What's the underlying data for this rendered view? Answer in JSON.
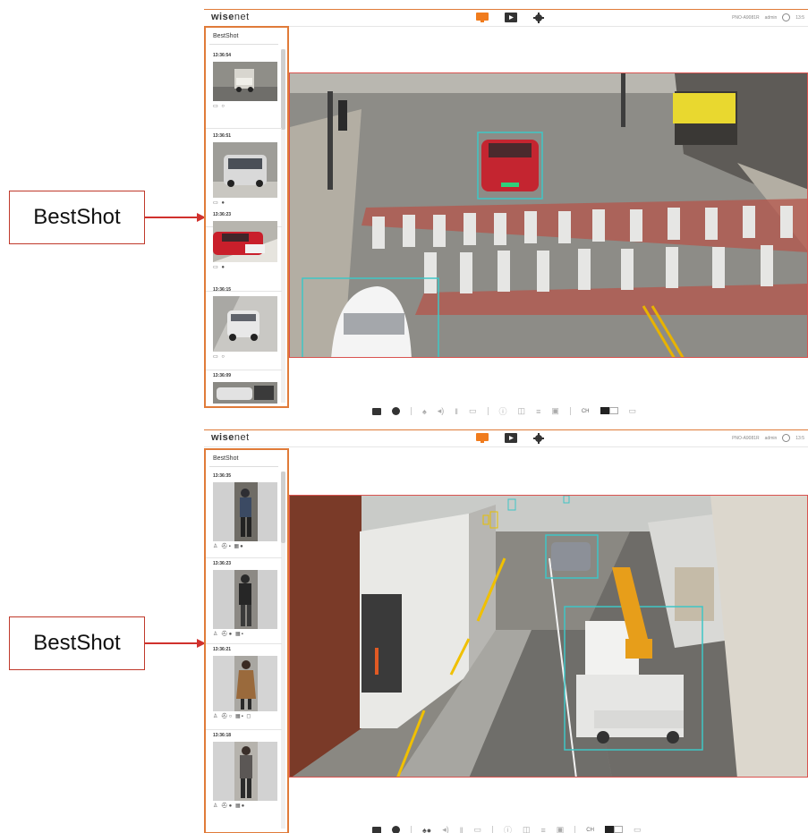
{
  "callouts": [
    {
      "label": "BestShot"
    },
    {
      "label": "BestShot"
    }
  ],
  "screens": [
    {
      "logo_bold": "wise",
      "logo_rest": "net",
      "top_right": "PNO-A9081R",
      "user": "admin",
      "time": "13:5",
      "panel_title": "BestShot",
      "entries": [
        {
          "time": "13:36:54",
          "icons": "▭ ○"
        },
        {
          "time": "13:36:51",
          "icons": "▭ ●"
        },
        {
          "time": "13:36:23",
          "icons": "▭ ●"
        },
        {
          "time": "13:36:15",
          "icons": "▭ ○"
        },
        {
          "time": "13:36:09",
          "icons": ""
        }
      ],
      "ch_label": "CH"
    },
    {
      "logo_bold": "wise",
      "logo_rest": "net",
      "top_right": "PNO-A9081R",
      "user": "admin",
      "time": "13:5",
      "panel_title": "BestShot",
      "entries": [
        {
          "time": "13:36:35",
          "icons": "♙ ⛑▪ ▦●"
        },
        {
          "time": "13:36:23",
          "icons": "♙ ⛑● ▦▪"
        },
        {
          "time": "13:36:21",
          "icons": "♙ ⛑○ ▦▪ ◻"
        },
        {
          "time": "13:36:18",
          "icons": "♙ ⛑● ▦●"
        }
      ],
      "ch_label": "CH"
    }
  ],
  "colors": {
    "accent": "#e07b39",
    "brand_orange": "#f07c1e",
    "alert_red": "#d9534f",
    "detection": "#3ec6c6"
  },
  "icons": [
    "monitor-icon",
    "playback-icon",
    "gear-icon",
    "clock-icon",
    "camera-icon",
    "record-icon",
    "alarm-icon",
    "audio-icon",
    "mic-icon",
    "region-icon",
    "info-icon",
    "rotate-icon",
    "text-icon",
    "overlay-icon",
    "channel-icon",
    "fullscreen-icon"
  ]
}
